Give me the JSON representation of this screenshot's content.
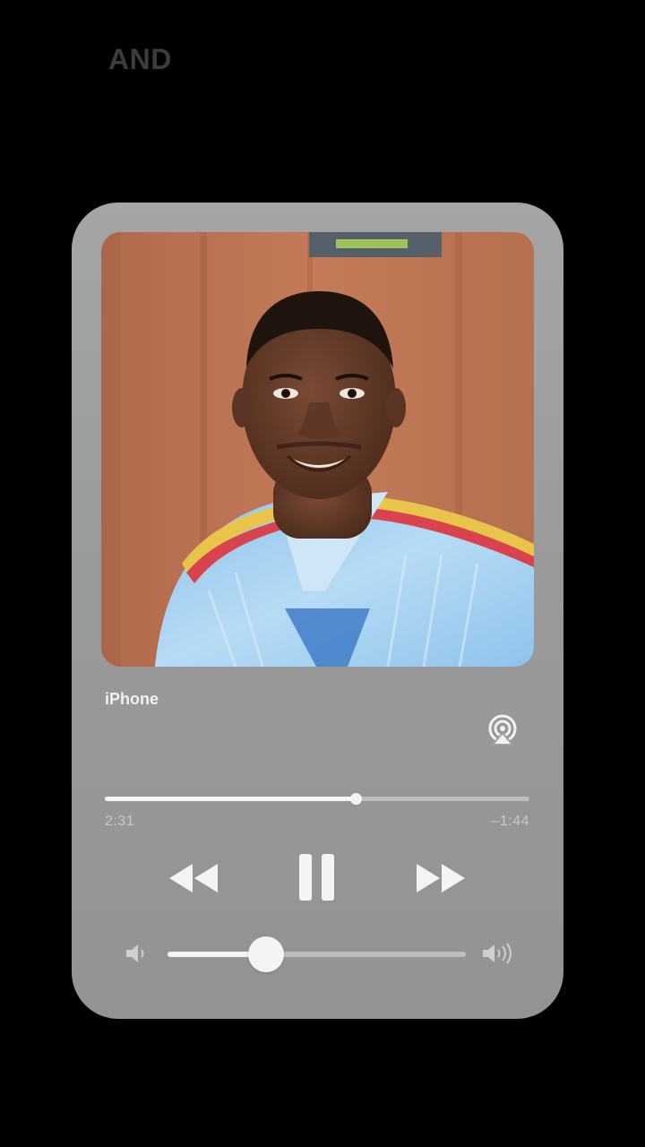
{
  "overlay": {
    "title": "AND"
  },
  "player": {
    "artwork": {
      "subject": "portrait-selfie"
    },
    "device_label": "iPhone",
    "airplay_icon": "airplay-icon",
    "progress": {
      "elapsed": "2:31",
      "remaining": "–1:44",
      "fraction": 0.59
    },
    "controls": {
      "rewind_icon": "rewind-icon",
      "pause_icon": "pause-icon",
      "forward_icon": "fast-forward-icon"
    },
    "volume": {
      "low_icon": "speaker-low-icon",
      "high_icon": "speaker-high-icon",
      "level": 0.33
    }
  },
  "colors": {
    "background": "#000000",
    "card": "#a0a0a0",
    "accent": "#f4f4f4",
    "track": "#bdbdbd"
  }
}
